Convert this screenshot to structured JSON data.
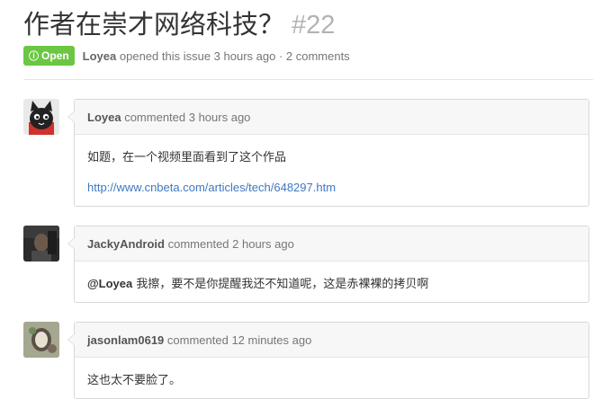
{
  "issue": {
    "title": "作者在崇才网络科技？",
    "number": "#22",
    "state": "Open",
    "author": "Loyea",
    "meta_text": "opened this issue 3 hours ago · 2 comments"
  },
  "comments": [
    {
      "author": "Loyea",
      "action": "commented 3 hours ago",
      "body_text": "如题，在一个视频里面看到了这个作品",
      "body_link": "http://www.cnbeta.com/articles/tech/648297.htm"
    },
    {
      "author": "JackyAndroid",
      "action": "commented 2 hours ago",
      "mention": "@Loyea",
      "body_text": " 我擦，要不是你提醒我还不知道呢，这是赤裸裸的拷贝啊"
    },
    {
      "author": "jasonlam0619",
      "action": "commented 12 minutes ago",
      "body_text": "这也太不要脸了。"
    }
  ],
  "colors": {
    "open_badge": "#6cc644",
    "link": "#4078c0",
    "header_bg": "#f7f7f7"
  },
  "icons": {
    "state": "issue-opened-icon"
  }
}
